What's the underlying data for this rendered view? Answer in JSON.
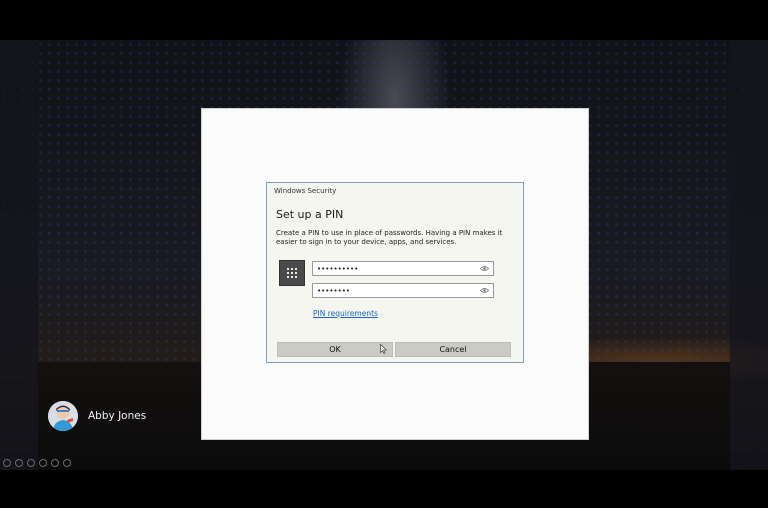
{
  "dialog": {
    "caption": "Windows Security",
    "title": "Set up a PIN",
    "description": "Create a PIN to use in place of passwords. Having a PIN makes it easier to sign in to your device, apps, and services.",
    "new_pin_value": "••••••••••",
    "confirm_pin_value": "••••••••",
    "pin_requirements_link": "PIN requirements",
    "ok_label": "OK",
    "cancel_label": "Cancel"
  },
  "user": {
    "name": "Abby Jones"
  },
  "icons": {
    "pin": "keypad-icon",
    "reveal": "eye-icon",
    "avatar": "user-avatar",
    "tray": [
      "accessibility-icon",
      "network-icon",
      "power-icon",
      "ease-of-access-icon",
      "language-icon",
      "settings-icon"
    ]
  },
  "colors": {
    "link": "#1a62c5",
    "dialog_border": "#7f9cc3",
    "button": "#cbcbc6"
  }
}
